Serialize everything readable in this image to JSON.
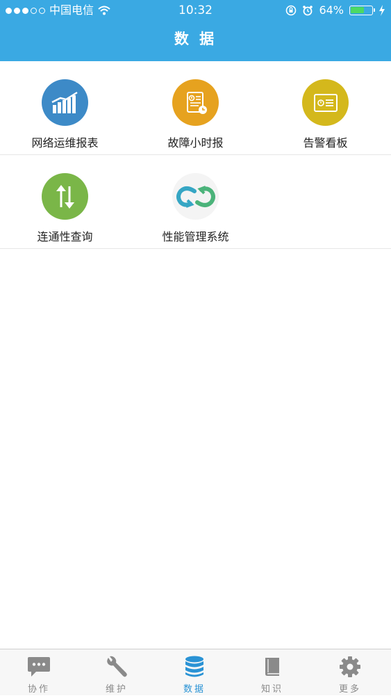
{
  "status_bar": {
    "carrier": "中国电信",
    "time": "10:32",
    "battery": "64%",
    "battery_level": 0.64
  },
  "nav": {
    "title": "数 据"
  },
  "grid": {
    "items": [
      {
        "label": "网络运维报表",
        "icon": "report-chart-icon",
        "color": "#3d8ac7"
      },
      {
        "label": "故障小时报",
        "icon": "fault-report-icon",
        "color": "#e6a21f"
      },
      {
        "label": "告警看板",
        "icon": "alarm-board-icon",
        "color": "#d4b81c"
      },
      {
        "label": "连通性查询",
        "icon": "updown-arrows-icon",
        "color": "#7ab648"
      },
      {
        "label": "性能管理系统",
        "icon": "performance-loop-icon",
        "color": "#36a6c4"
      }
    ]
  },
  "tabbar": {
    "items": [
      {
        "label": "协作",
        "icon": "chat-bubble-icon"
      },
      {
        "label": "维护",
        "icon": "wrench-icon"
      },
      {
        "label": "数据",
        "icon": "database-icon",
        "active": true
      },
      {
        "label": "知识",
        "icon": "book-icon"
      },
      {
        "label": "更多",
        "icon": "gear-icon"
      }
    ],
    "active_color": "#2a93d5",
    "inactive_color": "#8a8a8a"
  }
}
